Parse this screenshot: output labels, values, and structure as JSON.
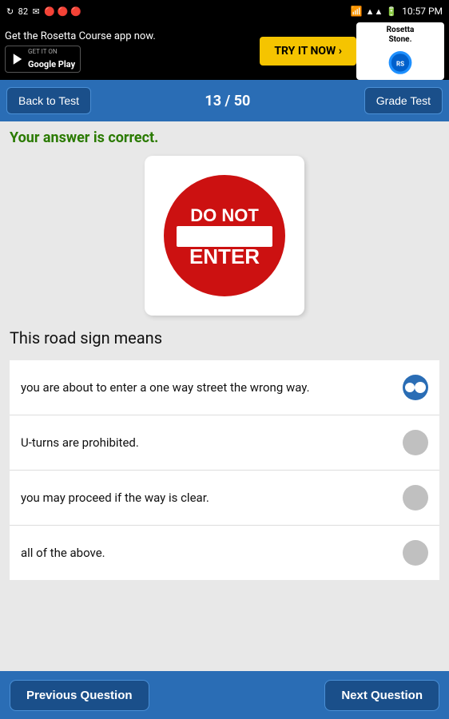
{
  "statusBar": {
    "leftIcons": "↻  82  ✉  👤 👤 👤",
    "time": "10:57 PM",
    "signal": "▲▲"
  },
  "adBanner": {
    "title": "Get the Rosetta Course app now.",
    "googlePlay": "GET IT ON  Google Play",
    "cta": "TRY IT NOW ›",
    "logoLine1": "Rosetta",
    "logoLine2": "Stone."
  },
  "nav": {
    "backLabel": "Back to Test",
    "counter": "13 / 50",
    "gradeLabel": "Grade Test"
  },
  "correctMessage": "Your answer is correct.",
  "questionText": "This road sign means",
  "options": [
    {
      "id": "opt1",
      "text": "you are about to enter a one way street the wrong way.",
      "selected": true
    },
    {
      "id": "opt2",
      "text": "U-turns are prohibited.",
      "selected": false
    },
    {
      "id": "opt3",
      "text": "you may proceed if the way is clear.",
      "selected": false
    },
    {
      "id": "opt4",
      "text": "all of the above.",
      "selected": false
    }
  ],
  "bottomBar": {
    "prevLabel": "Previous Question",
    "nextLabel": "Next Question"
  }
}
